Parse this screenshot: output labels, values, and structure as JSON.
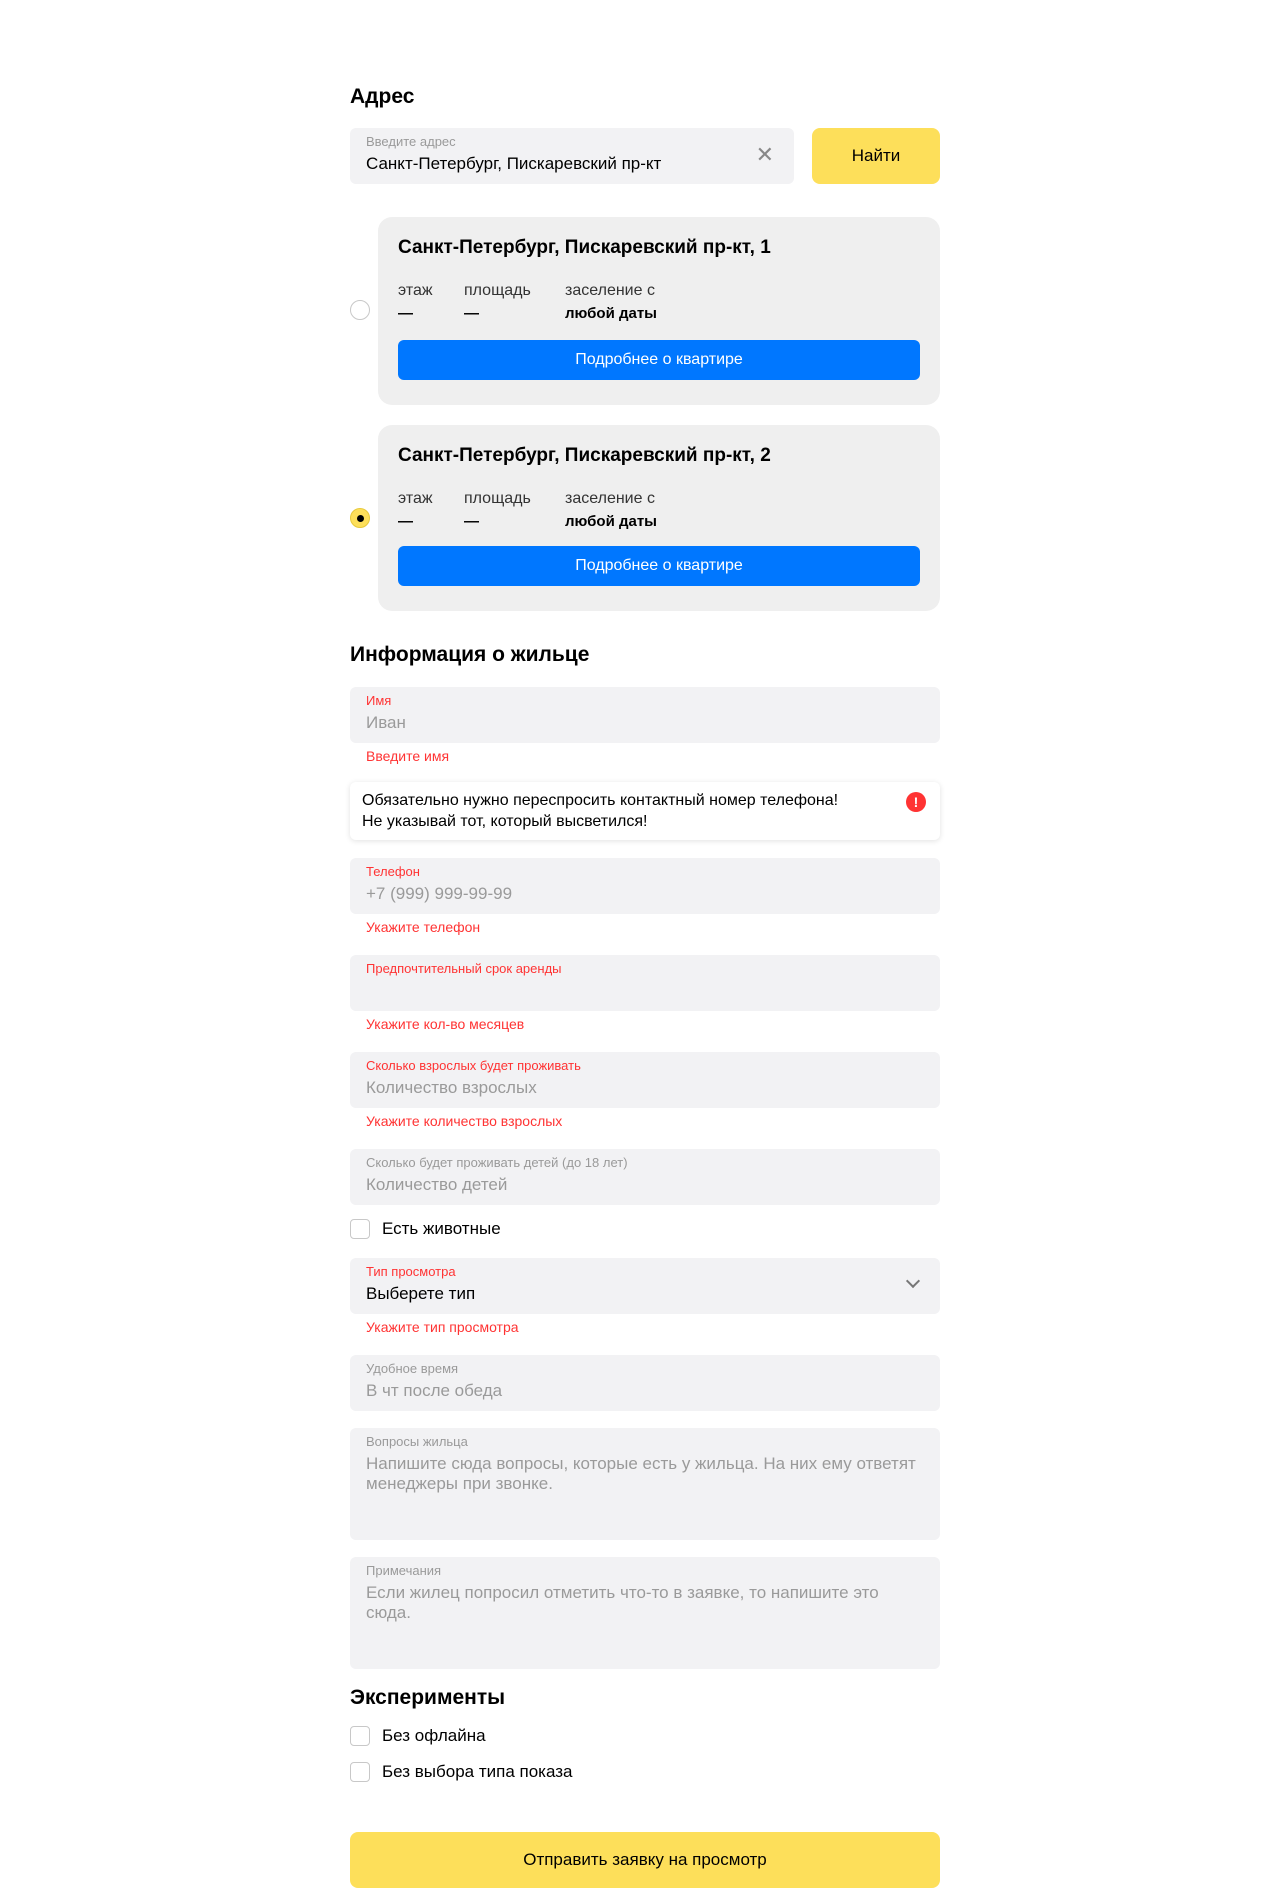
{
  "address": {
    "heading": "Адрес",
    "input_label": "Введите адрес",
    "input_value": "Санкт-Петербург, Пискаревский пр-кт",
    "find_button": "Найти"
  },
  "apartments": [
    {
      "title": "Санкт-Петербург, Пискаревский пр-кт, 1",
      "floor_label": "этаж",
      "floor_value": "—",
      "area_label": "площадь",
      "area_value": "—",
      "move_in_label": "заселение с",
      "move_in_value": "любой даты",
      "details_button": "Подробнее о квартире",
      "selected": false
    },
    {
      "title": "Санкт-Петербург, Пискаревский пр-кт, 2",
      "floor_label": "этаж",
      "floor_value": "—",
      "area_label": "площадь",
      "area_value": "—",
      "move_in_label": "заселение с",
      "move_in_value": "любой даты",
      "details_button": "Подробнее о квартире",
      "selected": true
    }
  ],
  "tenant": {
    "heading": "Информация о жильце",
    "name": {
      "label": "Имя",
      "placeholder": "Иван",
      "error": "Введите имя"
    },
    "notice": {
      "line1": "Обязательно нужно переспросить контактный номер телефона!",
      "line2": "Не указывай тот, который высветился!",
      "icon": "!"
    },
    "phone": {
      "label": "Телефон",
      "placeholder": "+7 (999) 999-99-99",
      "error": "Укажите телефон"
    },
    "rent_term": {
      "label": "Предпочтительный срок аренды",
      "error": "Укажите кол-во месяцев"
    },
    "adults": {
      "label": "Сколько взрослых будет проживать",
      "placeholder": "Количество взрослых",
      "error": "Укажите количество взрослых"
    },
    "children": {
      "label": "Сколько будет проживать детей (до 18 лет)",
      "placeholder": "Количество детей"
    },
    "pets_label": "Есть животные",
    "view_type": {
      "label": "Тип просмотра",
      "value": "Выберете тип",
      "error": "Укажите тип просмотра"
    },
    "convenient_time": {
      "label": "Удобное время",
      "placeholder": "В чт после обеда"
    },
    "questions": {
      "label": "Вопросы жильца",
      "placeholder": "Напишите сюда вопросы, которые есть у жильца. На них ему ответят менеджеры при звонке."
    },
    "notes": {
      "label": "Примечания",
      "placeholder": "Если жилец попросил отметить что-то в заявке, то напишите это сюда."
    }
  },
  "experiments": {
    "heading": "Эксперименты",
    "option1": "Без офлайна",
    "option2": "Без выбора типа показа"
  },
  "submit_button": "Отправить заявку на просмотр",
  "colors": {
    "accent_yellow": "#fddf5a",
    "primary_blue": "#0077ff",
    "error_red": "#ff3333",
    "field_bg": "#f2f2f4"
  }
}
